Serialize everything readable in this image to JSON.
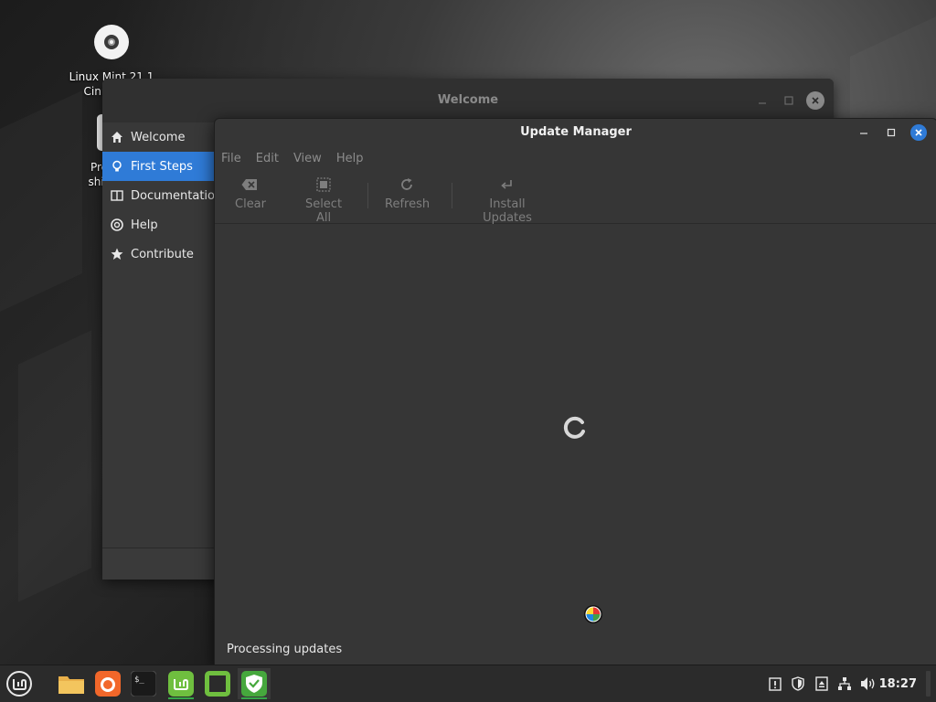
{
  "desktop": {
    "icons": [
      {
        "label_line1": "Linux Mint 21.1",
        "label_line2": "Cinnamon"
      },
      {
        "label_line1": "Prepare",
        "label_line2": "shipping"
      }
    ]
  },
  "welcome_window": {
    "title": "Welcome",
    "sidebar": [
      {
        "label": "Welcome",
        "icon": "home-icon"
      },
      {
        "label": "First Steps",
        "icon": "lightbulb-icon",
        "active": true
      },
      {
        "label": "Documentation",
        "icon": "book-icon"
      },
      {
        "label": "Help",
        "icon": "lifebuoy-icon"
      },
      {
        "label": "Contribute",
        "icon": "star-icon"
      }
    ]
  },
  "update_manager": {
    "title": "Update Manager",
    "menu": [
      "File",
      "Edit",
      "View",
      "Help"
    ],
    "toolbar": {
      "clear": "Clear",
      "select_all": "Select All",
      "refresh": "Refresh",
      "install_updates": "Install Updates"
    },
    "status": "Processing updates"
  },
  "taskbar": {
    "clock": "18:27",
    "accent": "#35a847"
  },
  "colors": {
    "selection": "#2f7bd7",
    "mint_green": "#6fbf3f"
  }
}
